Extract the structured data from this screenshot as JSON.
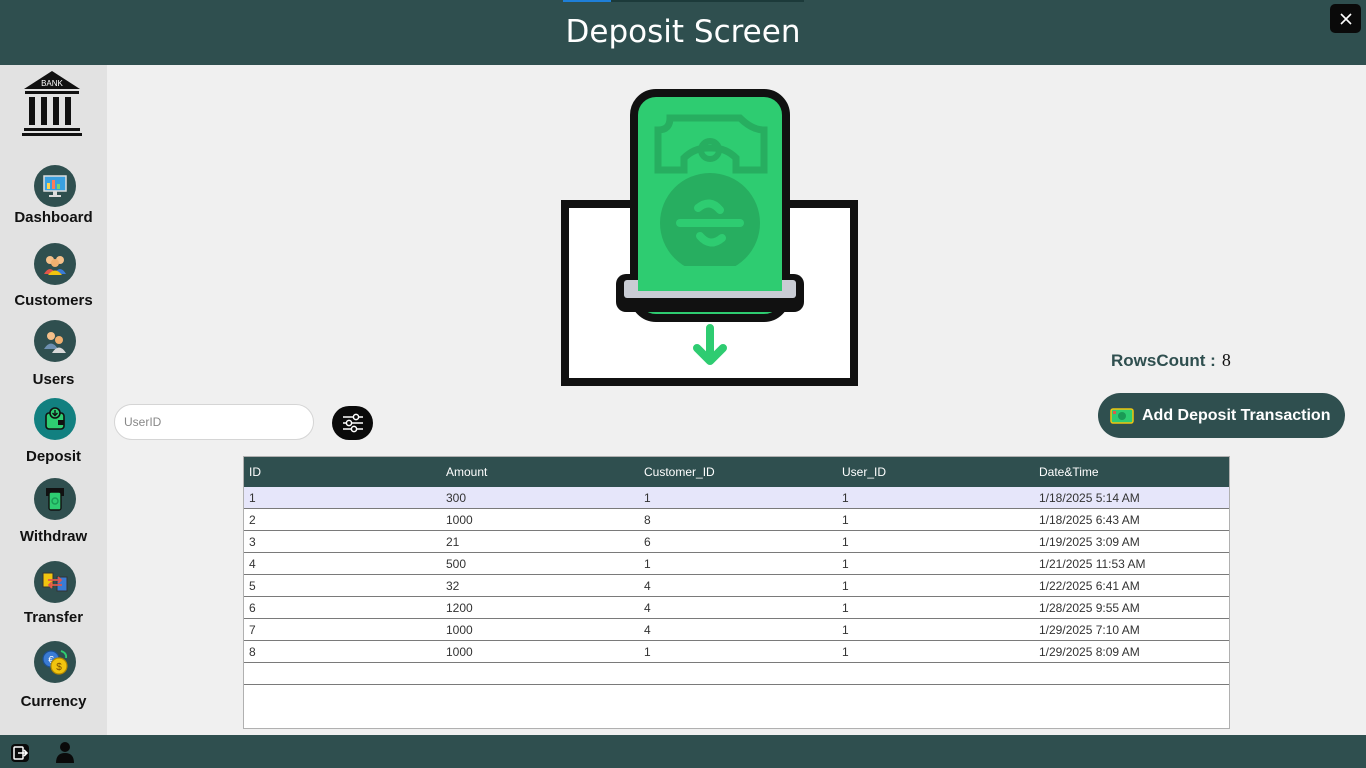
{
  "window": {
    "title": "Deposit Screen"
  },
  "sidebar": {
    "items": [
      {
        "label": "Dashboard",
        "icon": "dashboard-icon"
      },
      {
        "label": "Customers",
        "icon": "customers-icon"
      },
      {
        "label": "Users",
        "icon": "users-icon"
      },
      {
        "label": "Deposit",
        "icon": "deposit-icon",
        "active": true
      },
      {
        "label": "Withdraw",
        "icon": "withdraw-icon"
      },
      {
        "label": "Transfer",
        "icon": "transfer-icon"
      },
      {
        "label": "Currency",
        "icon": "currency-icon"
      }
    ],
    "logo_text": "BANK"
  },
  "main": {
    "rows_count_label": "RowsCount :",
    "rows_count_value": "8",
    "add_button_label": "Add Deposit Transaction",
    "search_placeholder": "UserID",
    "table": {
      "columns": [
        "ID",
        "Amount",
        "Customer_ID",
        "User_ID",
        "Date&Time"
      ],
      "rows": [
        [
          "1",
          "300",
          "1",
          "1",
          "1/18/2025 5:14 AM"
        ],
        [
          "2",
          "1000",
          "8",
          "1",
          "1/18/2025 6:43 AM"
        ],
        [
          "3",
          "21",
          "6",
          "1",
          "1/19/2025 3:09 AM"
        ],
        [
          "4",
          "500",
          "1",
          "1",
          "1/21/2025 11:53 AM"
        ],
        [
          "5",
          "32",
          "4",
          "1",
          "1/22/2025 6:41 AM"
        ],
        [
          "6",
          "1200",
          "4",
          "1",
          "1/28/2025 9:55 AM"
        ],
        [
          "7",
          "1000",
          "4",
          "1",
          "1/29/2025 7:10 AM"
        ],
        [
          "8",
          "1000",
          "1",
          "1",
          "1/29/2025 8:09 AM"
        ]
      ]
    }
  },
  "colors": {
    "primary": "#2f4f4f",
    "active": "#128080",
    "money_green": "#2ecc71",
    "selected_row": "#e6e6fa"
  }
}
